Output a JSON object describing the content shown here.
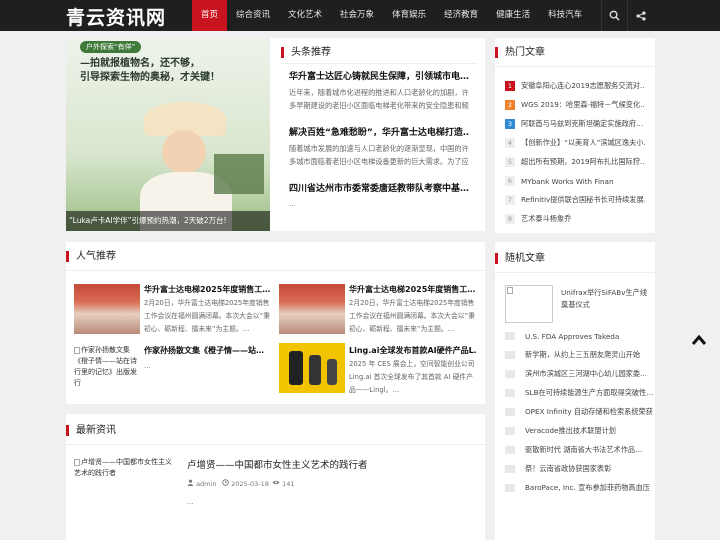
{
  "header": {
    "logo": "青云资讯网",
    "nav": [
      "首页",
      "综合资讯",
      "文化艺术",
      "社会万象",
      "体育娱乐",
      "经济教育",
      "健康生活",
      "科技汽车"
    ],
    "active_index": 0,
    "icons": [
      "search-icon",
      "share-icon"
    ]
  },
  "featured": {
    "tag": "户外探索“有佯”",
    "headline_line1": "—拍就报植物名，还不够，",
    "headline_line2": "引导探索生物的奥秘，才关键！",
    "caption": "“Luka卢卡AI学伴”引爆预约热潮，2天破2万台!"
  },
  "headlines": {
    "title": "头条推荐",
    "items": [
      {
        "title": "华升富士达匠心铸就民生保障，引领城市电…",
        "summary": "近年来，随着城市化进程的推进和人口老龄化的加剧，许多早期建设的老旧小区面临电梯老化带来的安全隐患和频繁故"
      },
      {
        "title": "解决百姓“急难愁盼”，华升富士达电梯打造…",
        "summary": "随着城市发展的加速与人口老龄化的逐渐显现，中国的许多城市面临着老旧小区电梯设备更新的巨大需求。为了应对这"
      },
      {
        "title": "四川省达州市市委常委唐廷教带队考察中基…",
        "summary": "..."
      }
    ]
  },
  "hot": {
    "title": "热门文章",
    "items": [
      "安徽阜阳心连心2019志愿服务交流对…",
      "WGS 2019：哈里森·福特－气候变化…",
      "阿联酋与马兹到克斯坦确定实施政府…",
      "【创新作业】“以美育人”滨城区逸夫小…",
      "超出所有预期，2019阿布扎比国际狩…",
      "MYbank Works With Finan",
      "Refinitiv提供联合国秘书长可持续发展…",
      "艺术泰斗杨象乔"
    ]
  },
  "popular": {
    "title": "人气推荐",
    "items": [
      {
        "title": "华升富士达电梯2025年度销售工…",
        "summary": "2月20日，华升富士达电梯2025年度销售工作会议在福州圆满闭幕。本次大会以“秉初心、砺新程、擂未来”为主题。…",
        "thumb": "crowd"
      },
      {
        "title": "华升富士达电梯2025年度销售工…",
        "summary": "2月20日，华升富士达电梯2025年度销售工作会议在福州圆满闭幕。本次大会以“秉初心、砺新程、擂未来”为主题。…",
        "thumb": "crowd"
      },
      {
        "title": "作家孙扬散文集《橙子情——站…",
        "summary": "...",
        "thumb_alt": "作家孙扬散文集《橙子情——站在诗行里的记忆》出版发行"
      },
      {
        "title": "Ling.ai全球发布首款AI硬件产品L…",
        "summary": "2025 年 CES 展会上，空间智能创业公司 Ling.ai 首次全球发布了其首款 AI 硬件产品——Lingl。…",
        "thumb": "yellow"
      }
    ]
  },
  "latest": {
    "title": "最新资讯",
    "item": {
      "thumb_alt": "卢增贤——中国都市女性主义艺术的践行者",
      "title": "卢增贤——中国都市女性主义艺术的践行者",
      "author": "admin",
      "date": "2025-03-18",
      "views": "141",
      "summary": "..."
    }
  },
  "random": {
    "title": "随机文章",
    "first": "Unifrax举行SiFABv生产线奠基仪式",
    "items": [
      "U.S. FDA Approves Takeda",
      "新学期，从约上三五朋友爬灵山开始",
      "滨州市滨城区三河湖中心幼儿园家委…",
      "SLB在可持续能源生产方面取得突破性…",
      "OPEX Infinity 自动存储和检索系统荣获",
      "Veracode推出技术联盟计划",
      "驱散新时代 湖南省大书法艺术作品…",
      "祭！云南省政协获国家表彰",
      "BaroPace, Inc. 宣布参加菲药物高血压"
    ]
  },
  "colors": {
    "accent": "#c8141e",
    "header_bg": "#1f1f1f",
    "page_bg": "#f0f0f0"
  }
}
